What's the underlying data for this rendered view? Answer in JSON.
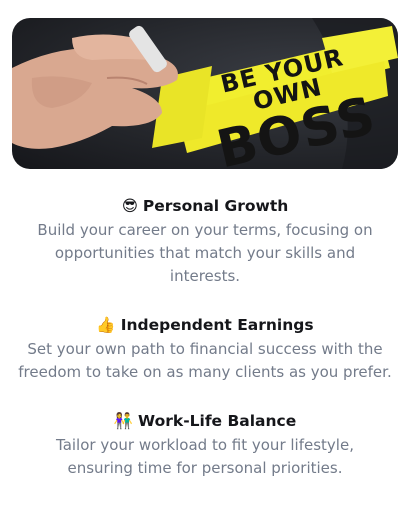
{
  "hero": {
    "line1": "BE YOUR OWN",
    "line2": "BOSS"
  },
  "features": [
    {
      "emoji": "😎",
      "title": "Personal Growth",
      "description": "Build your career on your terms, focusing on opportunities that match your skills and interests."
    },
    {
      "emoji": "👍",
      "title": "Independent Earnings",
      "description": "Set your own path to financial success with the freedom to take on as many clients as you prefer."
    },
    {
      "emoji": "👫",
      "title": "Work-Life Balance",
      "description": "Tailor your workload to fit your lifestyle, ensuring time for personal priorities."
    }
  ],
  "colors": {
    "highlight": "#f1ee2e",
    "text_dark": "#15161a",
    "text_muted": "#737b8a"
  }
}
